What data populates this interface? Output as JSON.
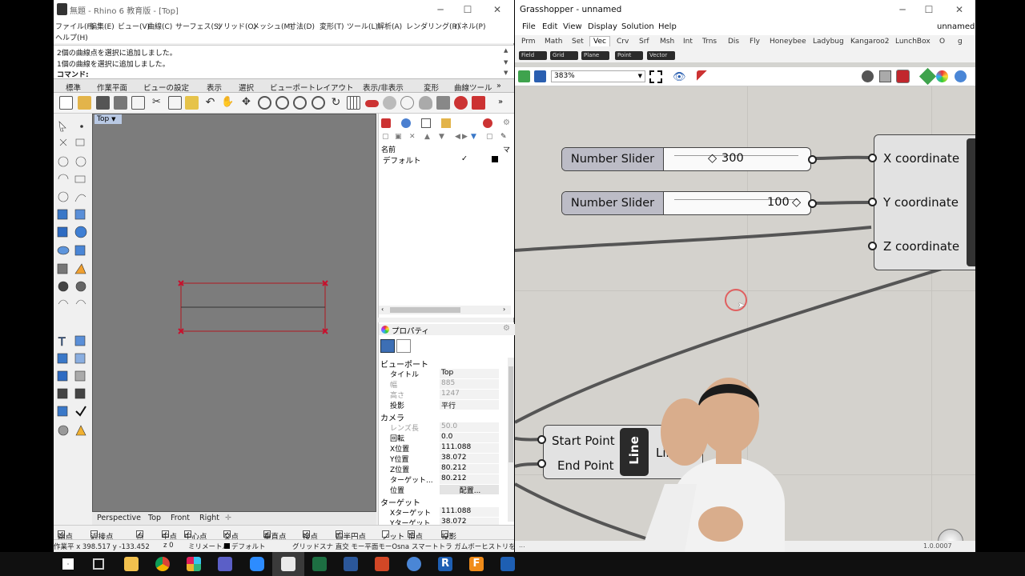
{
  "rhino": {
    "title": "無題 - Rhino 6 教育版 - [Top]",
    "menu": [
      "ファイル(F)",
      "編集(E)",
      "ビュー(V)",
      "曲線(C)",
      "サーフェス(S)",
      "ソリッド(O)",
      "メッシュ(M)",
      "寸法(D)",
      "変形(T)",
      "ツール(L)",
      "解析(A)",
      "レンダリング(R)",
      "パネル(P)",
      "ヘルプ(H)"
    ],
    "command_history": [
      "2個の曲線点を選択に追加しました。",
      "1個の曲線を選択に追加しました。"
    ],
    "command_prompt": "コマンド:",
    "tabs": [
      "標準",
      "作業平面",
      "ビューの設定",
      "表示",
      "選択",
      "ビューポートレイアウト",
      "表示/非表示",
      "変形",
      "曲線ツール"
    ],
    "viewport_label": "Top",
    "viewport_tabs": [
      "Perspective",
      "Top",
      "Front",
      "Right"
    ],
    "layers": {
      "header_name": "名前",
      "header_mat": "マ",
      "default_layer": "デフォルト",
      "check": "✓"
    },
    "properties": {
      "title": "プロパティ",
      "section_viewport": "ビューポート",
      "rows_viewport": [
        {
          "k": "タイトル",
          "v": "Top"
        },
        {
          "k": "幅",
          "v": "885"
        },
        {
          "k": "高さ",
          "v": "1247"
        },
        {
          "k": "投影",
          "v": "平行"
        }
      ],
      "section_camera": "カメラ",
      "rows_camera": [
        {
          "k": "レンズ長",
          "v": "50.0"
        },
        {
          "k": "回転",
          "v": "0.0"
        },
        {
          "k": "X位置",
          "v": "111.088"
        },
        {
          "k": "Y位置",
          "v": "38.072"
        },
        {
          "k": "Z位置",
          "v": "80.212"
        },
        {
          "k": "ターゲット...",
          "v": "80.212"
        },
        {
          "k": "位置",
          "v": "配置..."
        }
      ],
      "section_target": "ターゲット",
      "rows_target": [
        {
          "k": "Xターゲット",
          "v": "111.088"
        },
        {
          "k": "Yターゲット",
          "v": "38.072"
        }
      ]
    },
    "osnap": [
      "端点",
      "近接点",
      "点",
      "中点",
      "中心点",
      "交点",
      "垂直点",
      "接点",
      "四半円点",
      "ノット",
      "頂点",
      "投影"
    ],
    "osnap_checked": [
      true,
      false,
      true,
      true,
      true,
      true,
      true,
      true,
      true,
      false,
      true,
      false
    ],
    "status": {
      "coords": "作業平 x 398.517 y -133.452",
      "z": "z 0",
      "unit": "ミリメートル",
      "layer": "デフォルト",
      "modes": "グリッドスナ 直交 モー平面モーOsna スマートトラ ガムボーヒストリを記フィ"
    }
  },
  "grasshopper": {
    "title": "Grasshopper - unnamed",
    "doc_name": "unnamed",
    "menu": [
      "File",
      "Edit",
      "View",
      "Display",
      "Solution",
      "Help"
    ],
    "tabs": [
      "Prm",
      "Math",
      "Set",
      "Vec",
      "Crv",
      "Srf",
      "Msh",
      "Int",
      "Trns",
      "Dis",
      "Fly",
      "Honeybee",
      "Ladybug",
      "Kangaroo2",
      "LunchBox",
      "O",
      "g"
    ],
    "active_tab": "Vec",
    "subbar": [
      "Field",
      "Grid",
      "Plane",
      "Point",
      "Vector"
    ],
    "zoom": "383%",
    "slider1": {
      "label": "Number Slider",
      "value": "300",
      "fraction": 0.35
    },
    "slider2": {
      "label": "Number Slider",
      "value": "100",
      "fraction": 0.98
    },
    "point_component": {
      "inputs": [
        "X coordinate",
        "Y coordinate",
        "Z coordinate"
      ]
    },
    "line_component": {
      "inputs": [
        "Start Point",
        "End Point"
      ],
      "name": "Line",
      "output": "Line"
    },
    "version": "1.0.0007"
  },
  "colors": {
    "rhino_bg": "#f0f0f0",
    "viewport": "#7c7c7c",
    "gh_canvas": "#d4d2cd",
    "selection_red": "#c8102e",
    "taskbar": "#101010"
  },
  "taskbar_icons": [
    "windows-start-icon",
    "task-view-icon",
    "file-explorer-icon",
    "chrome-icon",
    "slack-icon",
    "teams-icon",
    "zoom-icon",
    "zoom-icon-2",
    "rhino-icon",
    "excel-icon",
    "word-icon",
    "powerpoint-icon",
    "globe-icon",
    "r-icon",
    "f-icon",
    "vs-icon"
  ]
}
